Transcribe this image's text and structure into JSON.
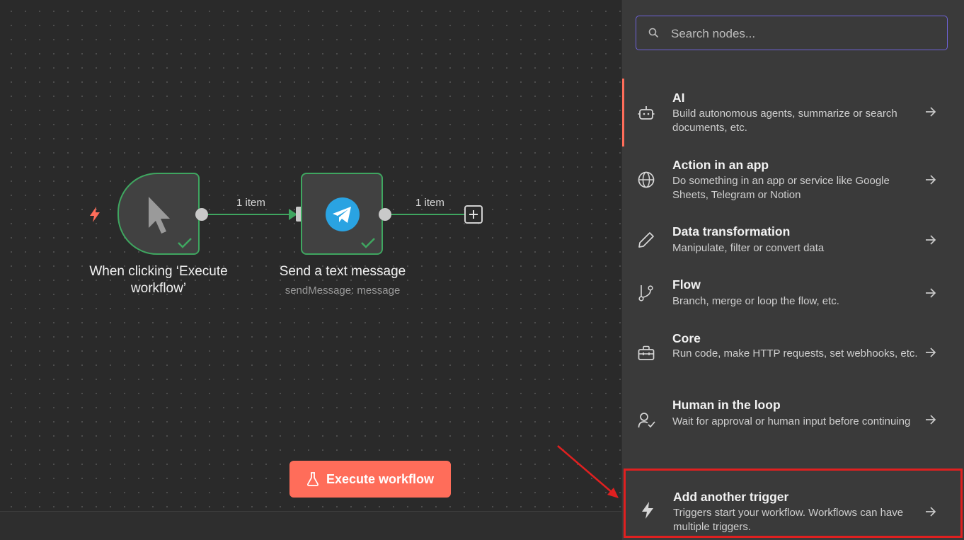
{
  "canvas": {
    "trigger_node": {
      "title": "When clicking ‘Execute workflow’",
      "icon": "mouse-pointer-icon",
      "status_icon": "check-icon"
    },
    "telegram_node": {
      "title": "Send a text message",
      "subtitle": "sendMessage: message",
      "icon": "telegram-icon",
      "status_icon": "check-icon"
    },
    "connections": [
      {
        "label": "1 item"
      },
      {
        "label": "1 item"
      }
    ],
    "execute_button": {
      "label": "Execute workflow",
      "icon": "flask-icon"
    },
    "colors": {
      "accent": "#ff6d5a",
      "success": "#3fa660",
      "telegram": "#2aa3e2"
    }
  },
  "panel": {
    "search": {
      "placeholder": "Search nodes..."
    },
    "categories": [
      {
        "title": "AI",
        "description": "Build autonomous agents, summarize or search documents, etc.",
        "icon": "robot-icon"
      },
      {
        "title": "Action in an app",
        "description": "Do something in an app or service like Google Sheets, Telegram or Notion",
        "icon": "globe-icon"
      },
      {
        "title": "Data transformation",
        "description": "Manipulate, filter or convert data",
        "icon": "pencil-icon"
      },
      {
        "title": "Flow",
        "description": "Branch, merge or loop the flow, etc.",
        "icon": "git-branch-icon"
      },
      {
        "title": "Core",
        "description": "Run code, make HTTP requests, set webhooks, etc.",
        "icon": "toolbox-icon"
      },
      {
        "title": "Human in the loop",
        "description": "Wait for approval or human input before continuing",
        "icon": "user-check-icon"
      },
      {
        "title": "Add another trigger",
        "description": "Triggers start your workflow. Workflows can have multiple triggers.",
        "icon": "bolt-icon"
      }
    ]
  }
}
